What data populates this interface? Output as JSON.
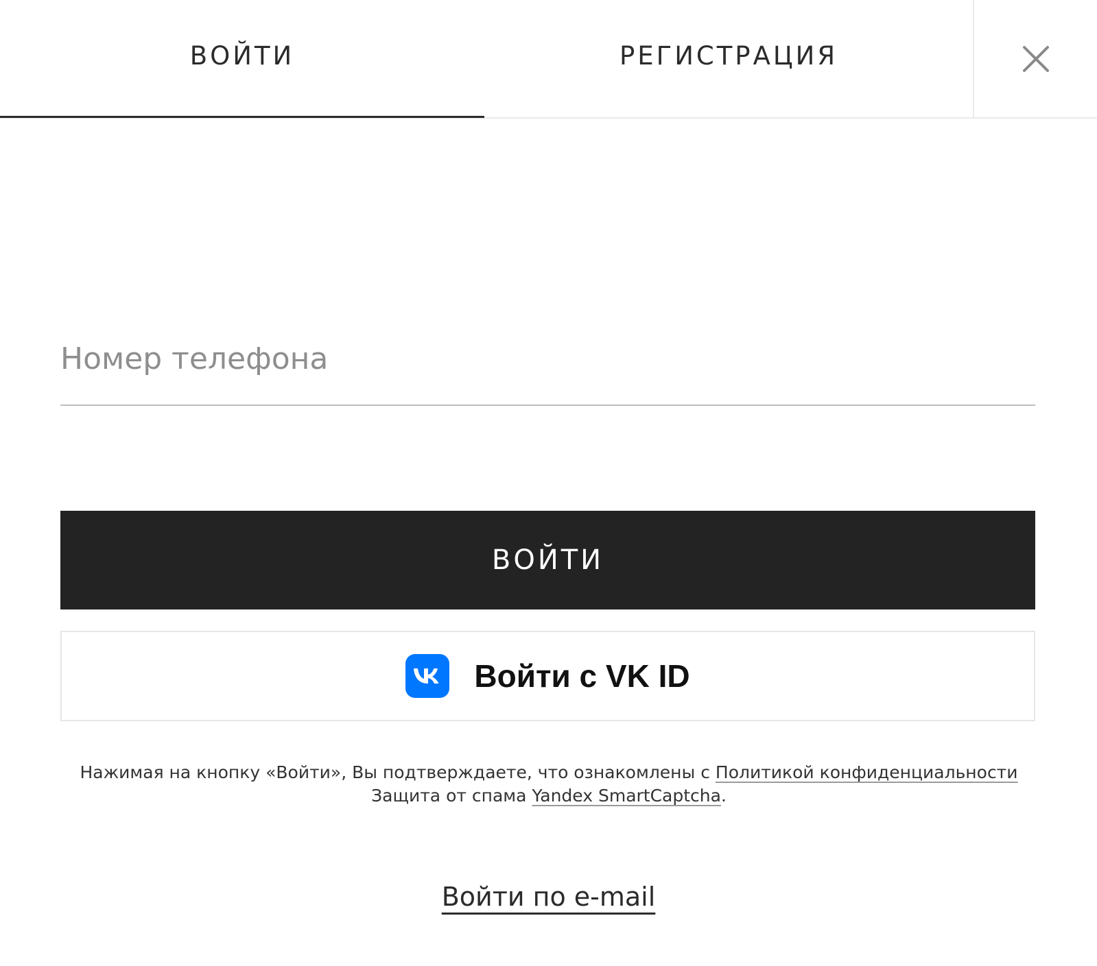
{
  "tabs": {
    "login_label": "ВОЙТИ",
    "register_label": "РЕГИСТРАЦИЯ",
    "active": "login"
  },
  "close": {
    "icon": "close-icon"
  },
  "form": {
    "phone_placeholder": "Номер телефона",
    "phone_value": "",
    "login_button_label": "ВОЙТИ",
    "vk_button_label": "Войти с VK ID",
    "vk_icon": "vk-logo-icon"
  },
  "disclaimer": {
    "line1_text": "Нажимая на кнопку «Войти», Вы подтверждаете, что ознакомлены с ",
    "privacy_link": "Политикой конфиденциальности",
    "line2_text": "Защита от спама ",
    "captcha_link": "Yandex SmartCaptcha",
    "line2_end": "."
  },
  "email_login_label": "Войти по e-mail",
  "colors": {
    "button_dark": "#232323",
    "vk_blue": "#0077ff",
    "text": "#2b2b2b",
    "placeholder": "#8e8e8e"
  }
}
